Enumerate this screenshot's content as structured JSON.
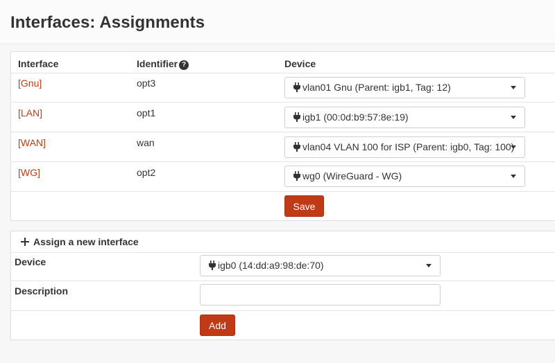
{
  "page": {
    "title": "Interfaces: Assignments"
  },
  "assignments": {
    "columns": {
      "interface": "Interface",
      "identifier": "Identifier",
      "device": "Device"
    },
    "help_icon": "question-circle-icon",
    "rows": [
      {
        "interface": "[Gnu]",
        "identifier": "opt3",
        "device": "vlan01 Gnu (Parent: igb1, Tag: 12)"
      },
      {
        "interface": "[LAN]",
        "identifier": "opt1",
        "device": "igb1 (00:0d:b9:57:8e:19)"
      },
      {
        "interface": "[WAN]",
        "identifier": "wan",
        "device": "vlan04 VLAN 100 for ISP (Parent: igb0, Tag: 100)"
      },
      {
        "interface": "[WG]",
        "identifier": "opt2",
        "device": "wg0 (WireGuard - WG)"
      }
    ],
    "save_label": "Save"
  },
  "new_interface": {
    "title": "Assign a new interface",
    "device_label": "Device",
    "device_value": "igb0 (14:dd:a9:98:de:70)",
    "description_label": "Description",
    "description_value": "",
    "description_placeholder": "",
    "add_label": "Add"
  },
  "colors": {
    "accent": "#c03a16",
    "link": "#c03a16"
  }
}
